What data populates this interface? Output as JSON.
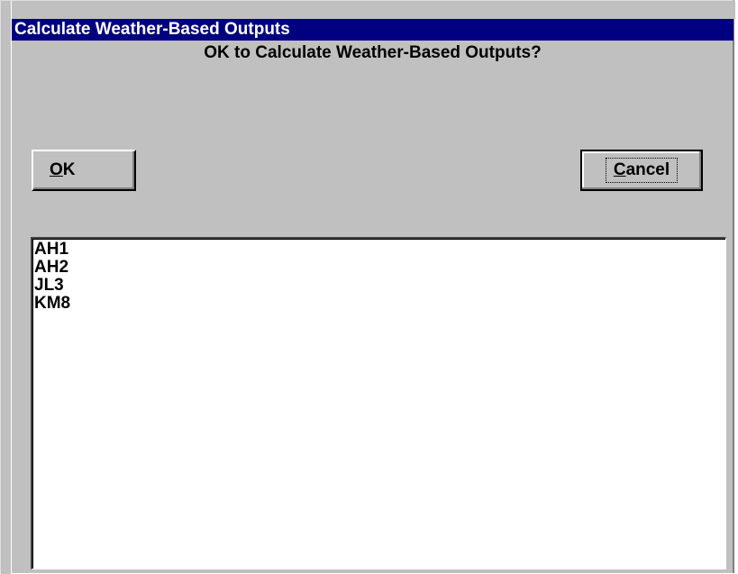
{
  "window": {
    "title": "Calculate Weather-Based Outputs"
  },
  "dialog": {
    "prompt": "OK to Calculate Weather-Based Outputs?"
  },
  "buttons": {
    "ok": {
      "mnemonic": "O",
      "rest": "K"
    },
    "cancel": {
      "mnemonic": "C",
      "rest": "ancel"
    }
  },
  "list": {
    "items": [
      "AH1",
      "AH2",
      "JL3",
      "KM8"
    ]
  },
  "colors": {
    "titlebar": "#000080",
    "face": "#c0c0c0",
    "list_bg": "#ffffff"
  }
}
